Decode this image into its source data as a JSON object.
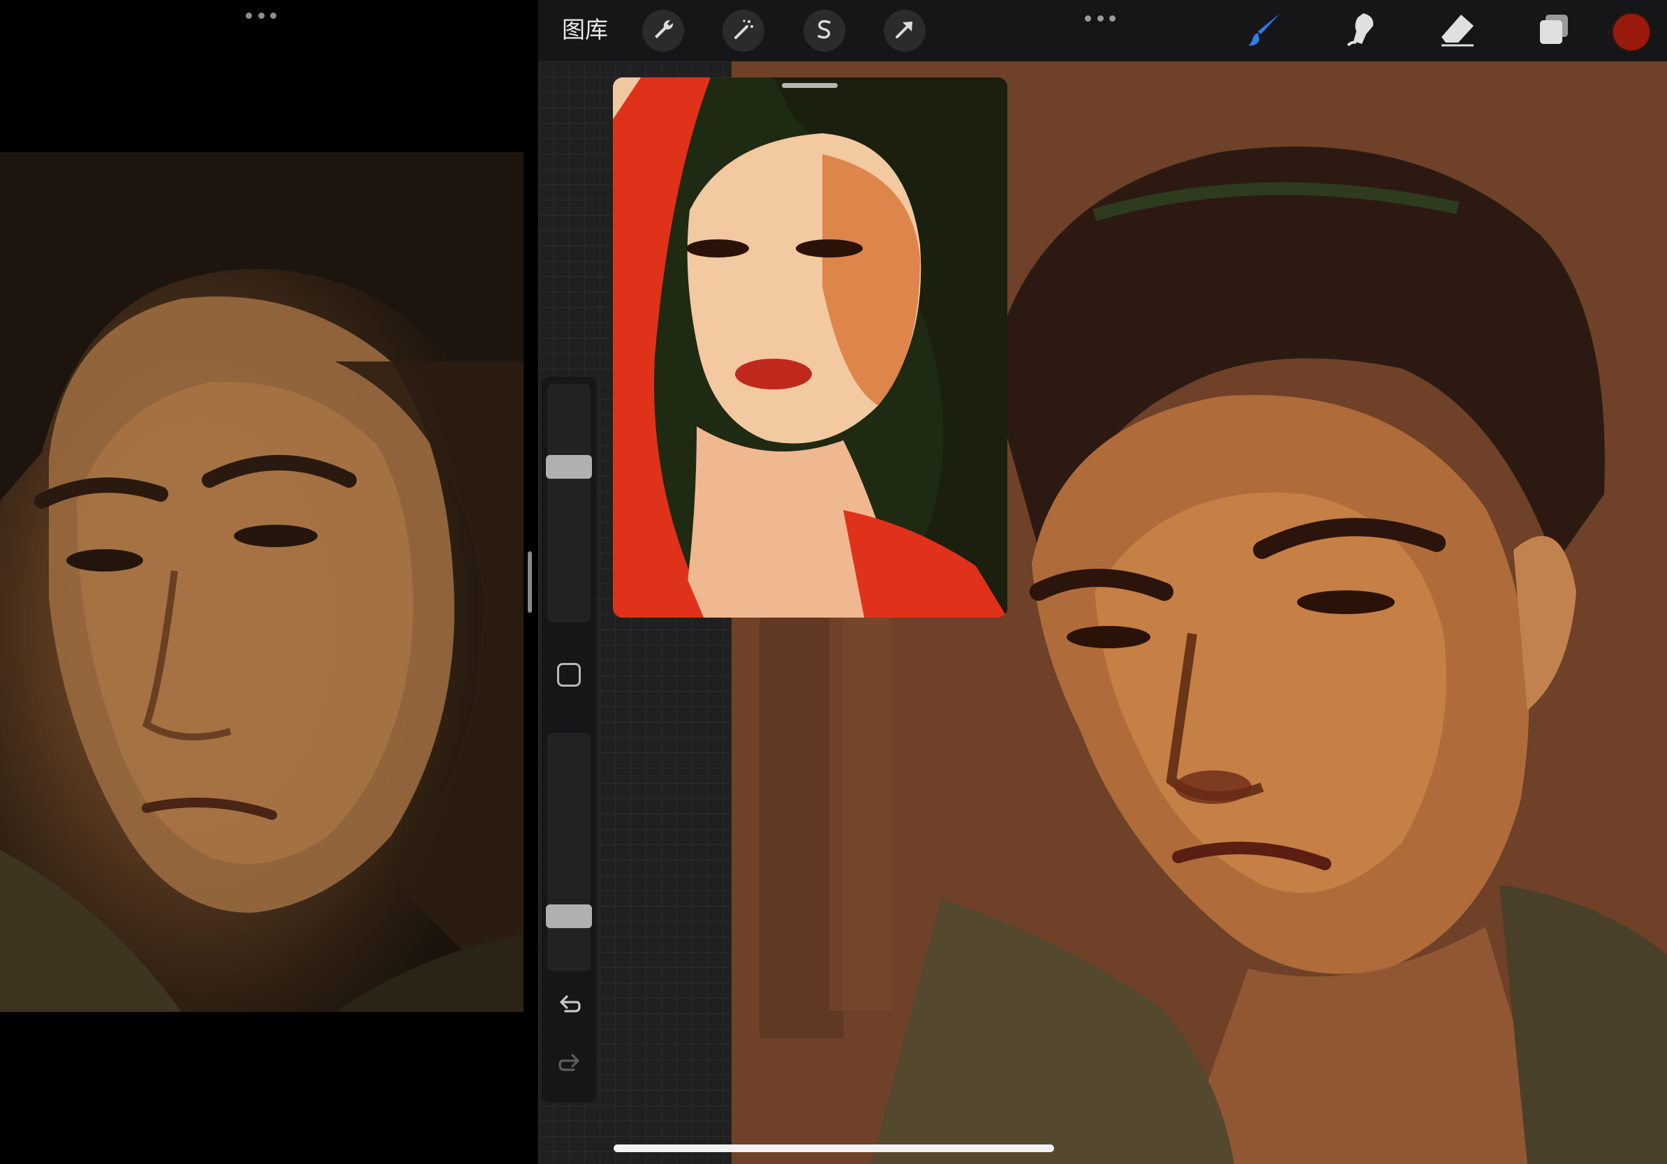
{
  "toolbar": {
    "gallery_label": "图库",
    "icons": [
      "wrench-icon",
      "magic-wand-icon",
      "selection-s-icon",
      "transform-arrow-icon"
    ],
    "right_icons": [
      "brush-icon",
      "smudge-icon",
      "eraser-icon",
      "layers-icon"
    ],
    "brush_active_color": "#2f7cf6",
    "current_color": "#9b1a0e"
  },
  "sidebar": {
    "brush_size_level": 0.67,
    "opacity_level": 0.2
  },
  "colors": {
    "accent": "#2f7cf6",
    "toolbar_bg": "#161618",
    "canvas_bg": "#1f1f21"
  }
}
